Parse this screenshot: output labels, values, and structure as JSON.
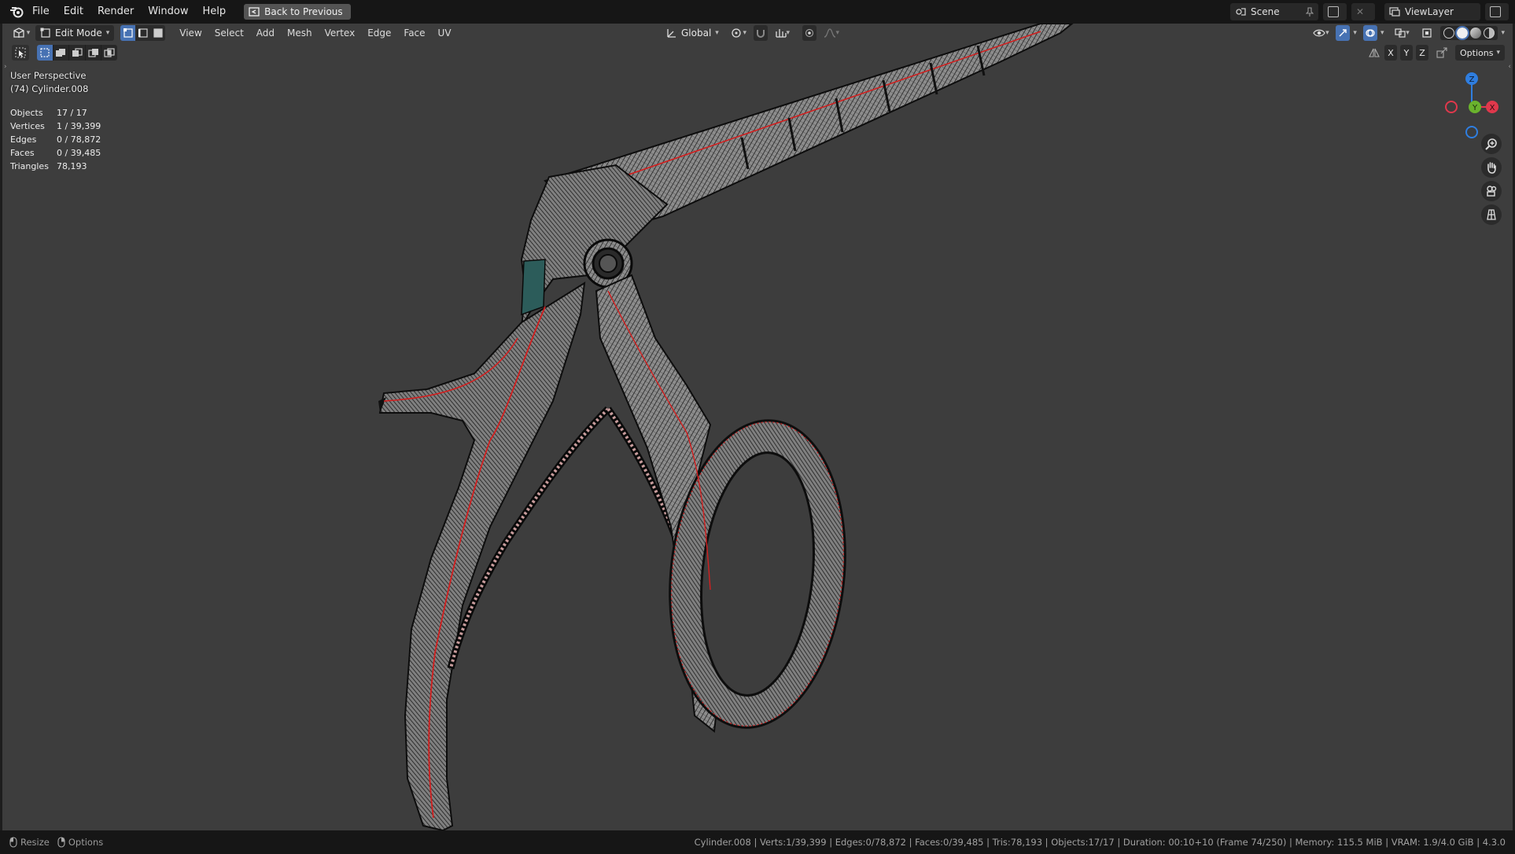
{
  "menubar": {
    "items": [
      "File",
      "Edit",
      "Render",
      "Window",
      "Help"
    ],
    "back_button": "Back to Previous",
    "scene": "Scene",
    "view_layer": "ViewLayer"
  },
  "viewport_header": {
    "mode": "Edit Mode",
    "menus": [
      "View",
      "Select",
      "Add",
      "Mesh",
      "Vertex",
      "Edge",
      "Face",
      "UV"
    ],
    "transform_orientation": "Global",
    "options_label": "Options",
    "axes": [
      "X",
      "Y",
      "Z"
    ]
  },
  "overlay": {
    "view_name": "User Perspective",
    "object_name": "(74) Cylinder.008",
    "stats": [
      {
        "label": "Objects",
        "value": "17 / 17"
      },
      {
        "label": "Vertices",
        "value": "1 / 39,399"
      },
      {
        "label": "Edges",
        "value": "0 / 78,872"
      },
      {
        "label": "Faces",
        "value": "0 / 39,485"
      },
      {
        "label": "Triangles",
        "value": "78,193"
      }
    ]
  },
  "gizmo": {
    "x": "X",
    "y": "Y",
    "z": "Z"
  },
  "statusbar": {
    "left": [
      "Resize",
      "Options"
    ],
    "info": "Cylinder.008 | Verts:1/39,399 | Edges:0/78,872 | Faces:0/39,485 | Tris:78,193 | Objects:17/17 | Duration: 00:10+10 (Frame 74/250) | Memory: 115.5 MiB | VRAM: 1.9/4.0 GiB | 4.3.0"
  },
  "colors": {
    "viewport_bg": "#3d3d3d",
    "active_blue": "#4772b3",
    "seam_red": "#d21f1f",
    "axis_x": "#e0384c",
    "axis_y": "#6ab22d",
    "axis_z": "#2f7ee0"
  }
}
